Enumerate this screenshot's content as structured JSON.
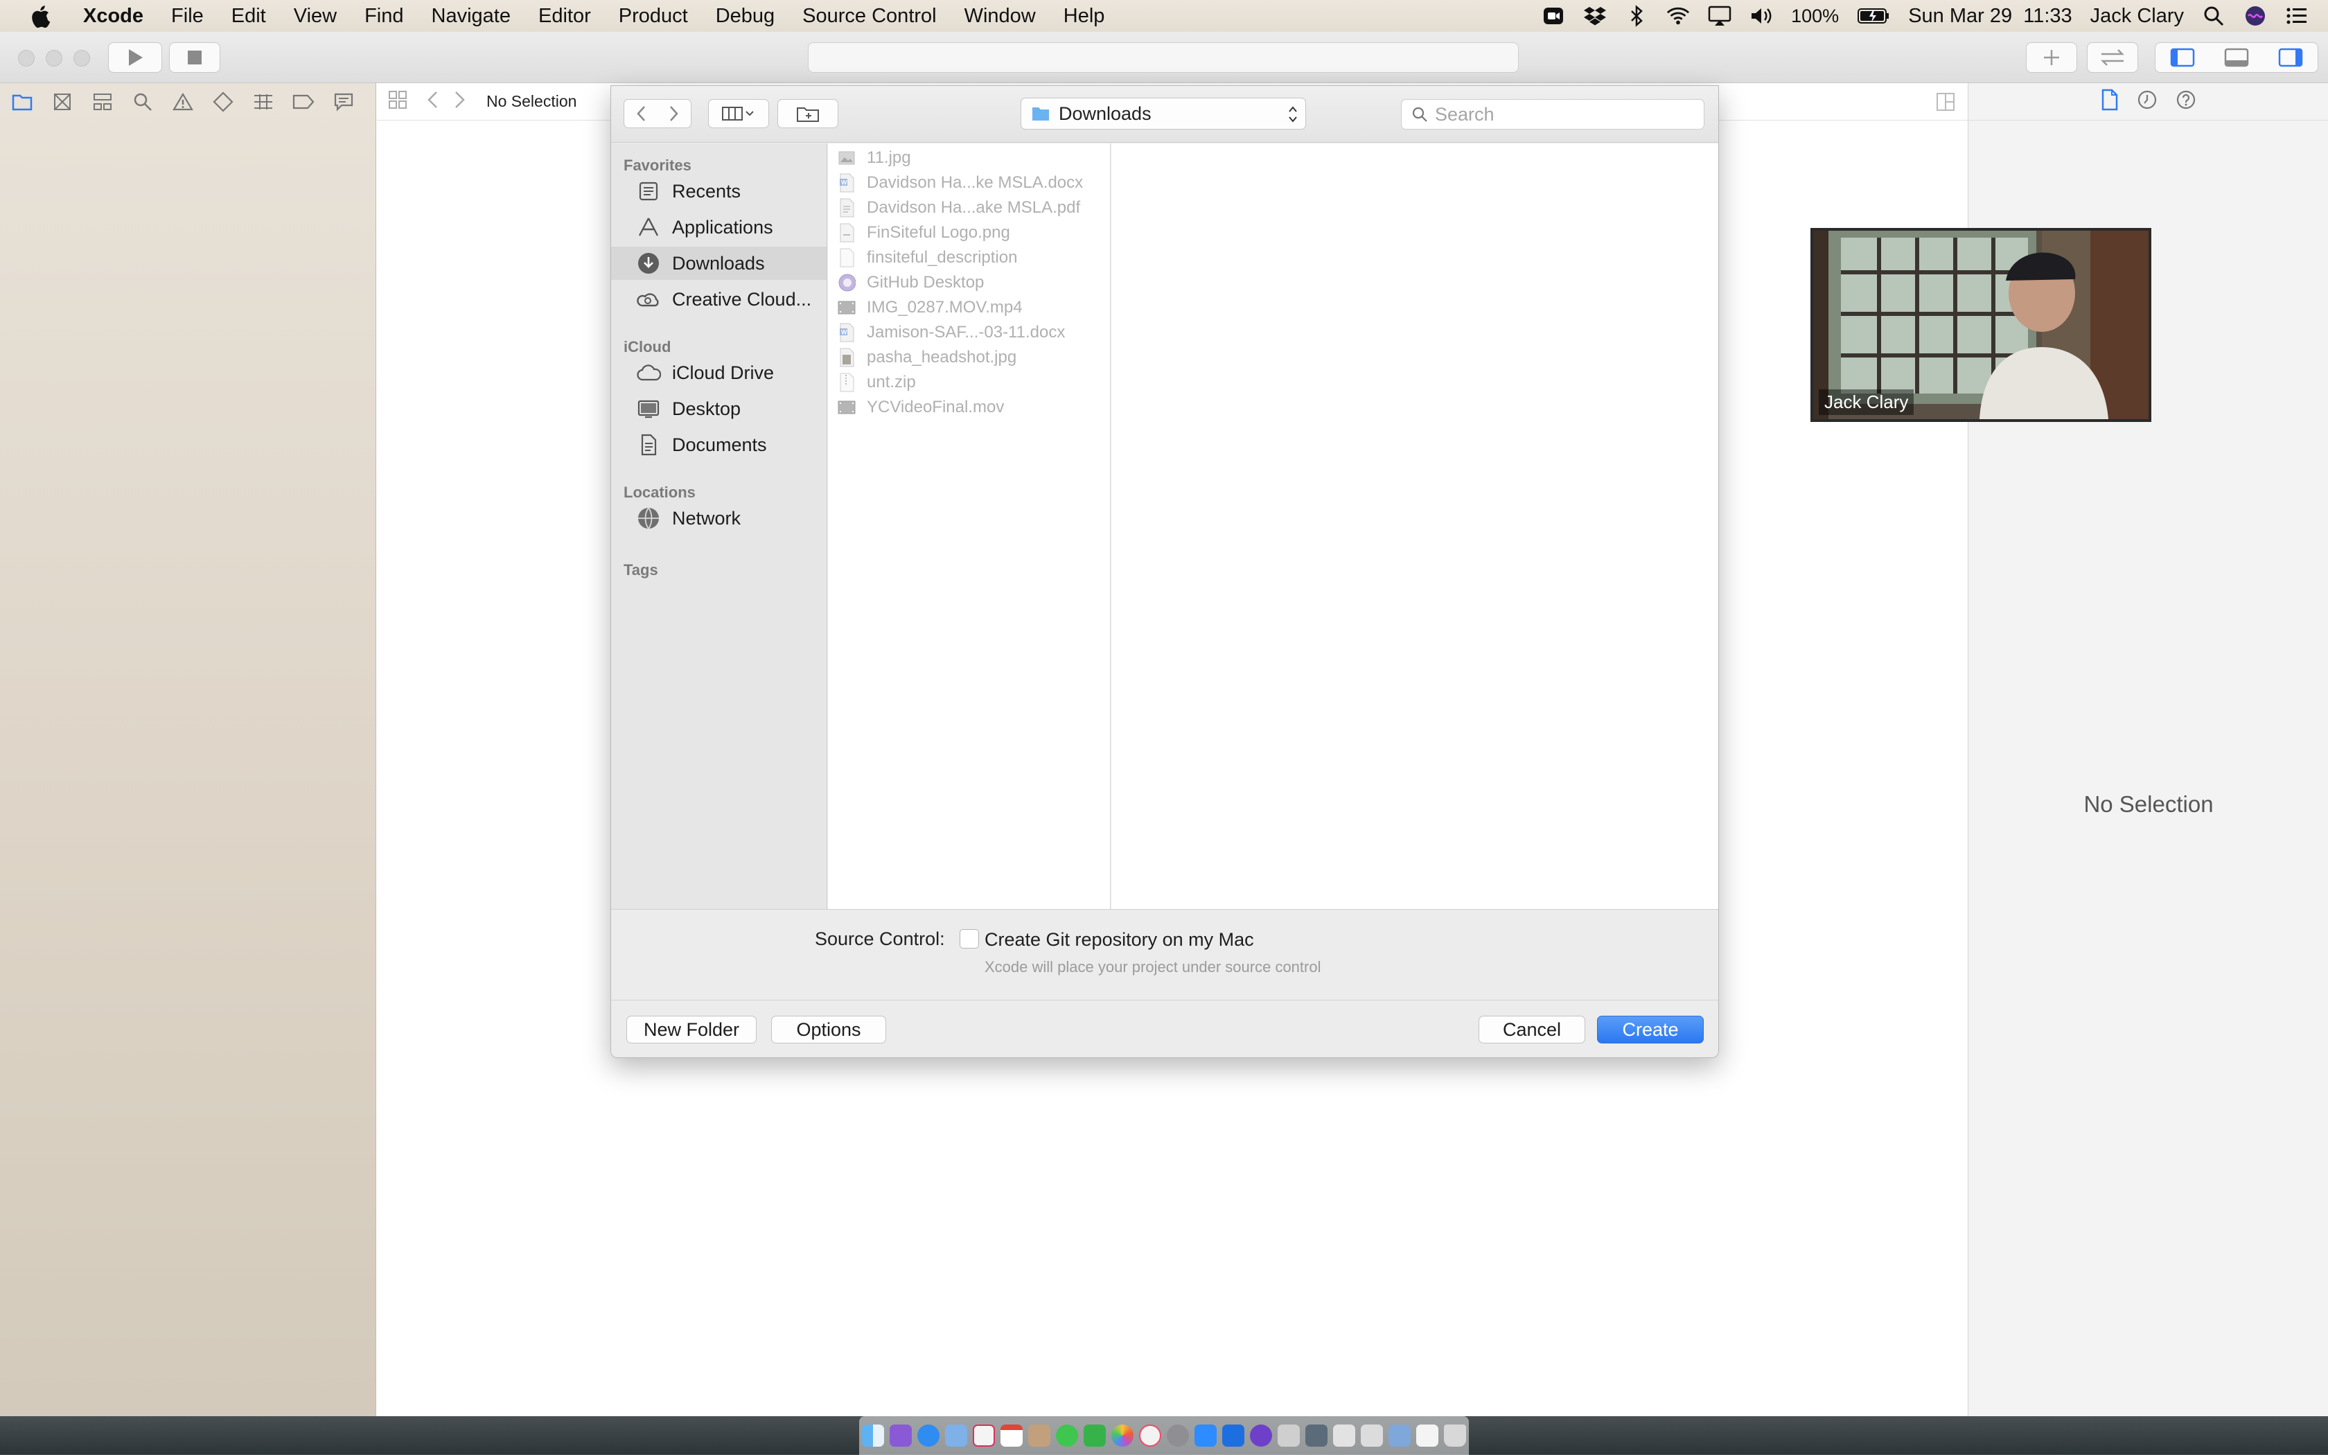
{
  "menubar": {
    "app_name": "Xcode",
    "items": [
      "File",
      "Edit",
      "View",
      "Find",
      "Navigate",
      "Editor",
      "Product",
      "Debug",
      "Source Control",
      "Window",
      "Help"
    ],
    "battery": "100%",
    "datetime": "Sun Mar 29  11:33",
    "user": "Jack Clary"
  },
  "xcode": {
    "jumpbar_label": "No Selection",
    "inspector_empty": "No Selection"
  },
  "dialog": {
    "location": "Downloads",
    "search_placeholder": "Search",
    "sidebar": {
      "favorites_title": "Favorites",
      "favorites": [
        {
          "label": "Recents",
          "icon": "clock-icon"
        },
        {
          "label": "Applications",
          "icon": "applications-icon"
        },
        {
          "label": "Downloads",
          "icon": "downloads-icon",
          "selected": true
        },
        {
          "label": "Creative Cloud...",
          "icon": "creative-cloud-icon"
        }
      ],
      "icloud_title": "iCloud",
      "icloud": [
        {
          "label": "iCloud Drive",
          "icon": "cloud-icon"
        },
        {
          "label": "Desktop",
          "icon": "desktop-icon"
        },
        {
          "label": "Documents",
          "icon": "documents-icon"
        }
      ],
      "locations_title": "Locations",
      "locations": [
        {
          "label": "Network",
          "icon": "network-icon"
        }
      ],
      "tags_title": "Tags"
    },
    "files": [
      {
        "name": "11.jpg",
        "icon": "image-file-icon"
      },
      {
        "name": "Davidson Ha...ke MSLA.docx",
        "icon": "word-file-icon"
      },
      {
        "name": "Davidson Ha...ake MSLA.pdf",
        "icon": "pdf-file-icon"
      },
      {
        "name": "FinSiteful Logo.png",
        "icon": "image-file-icon"
      },
      {
        "name": "finsiteful_description",
        "icon": "document-file-icon"
      },
      {
        "name": "GitHub Desktop",
        "icon": "app-icon"
      },
      {
        "name": "IMG_0287.MOV.mp4",
        "icon": "video-file-icon"
      },
      {
        "name": "Jamison-SAF...-03-11.docx",
        "icon": "word-file-icon"
      },
      {
        "name": "pasha_headshot.jpg",
        "icon": "image-file-icon"
      },
      {
        "name": "unt.zip",
        "icon": "zip-file-icon"
      },
      {
        "name": "YCVideoFinal.mov",
        "icon": "video-file-icon"
      }
    ],
    "source_control": {
      "label": "Source Control:",
      "checkbox_label": "Create Git repository on my Mac",
      "checked": false,
      "hint": "Xcode will place your project under source control"
    },
    "buttons": {
      "new_folder": "New Folder",
      "options": "Options",
      "cancel": "Cancel",
      "create": "Create"
    }
  },
  "zoom": {
    "participant_name": "Jack Clary"
  },
  "colors": {
    "accent": "#2b78f0",
    "selected_sidebar": "#d7d7d7"
  }
}
